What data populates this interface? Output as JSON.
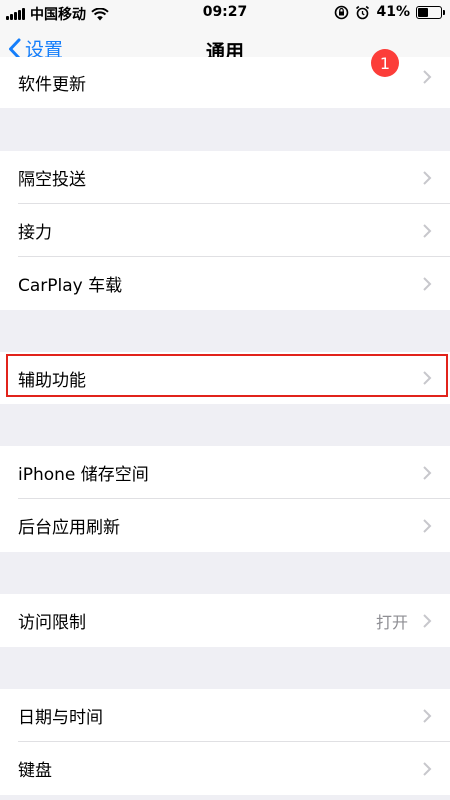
{
  "status_bar": {
    "carrier": "中国移动",
    "time": "09:27",
    "battery_percent": "41%",
    "battery_level": 0.41
  },
  "nav": {
    "back_label": "设置",
    "title": "通用"
  },
  "rows": {
    "software_update": {
      "label": "软件更新",
      "badge": "1"
    },
    "airdrop": {
      "label": "隔空投送"
    },
    "handoff": {
      "label": "接力"
    },
    "carplay": {
      "label": "CarPlay 车载"
    },
    "accessibility": {
      "label": "辅助功能"
    },
    "iphone_storage": {
      "label": "iPhone 储存空间"
    },
    "background_refresh": {
      "label": "后台应用刷新"
    },
    "restrictions": {
      "label": "访问限制",
      "value": "打开"
    },
    "date_time": {
      "label": "日期与时间"
    },
    "keyboard": {
      "label": "键盘"
    }
  },
  "colors": {
    "accent": "#147efb",
    "badge": "#fc3d39",
    "highlight": "#e1231b",
    "background": "#efeff4"
  }
}
